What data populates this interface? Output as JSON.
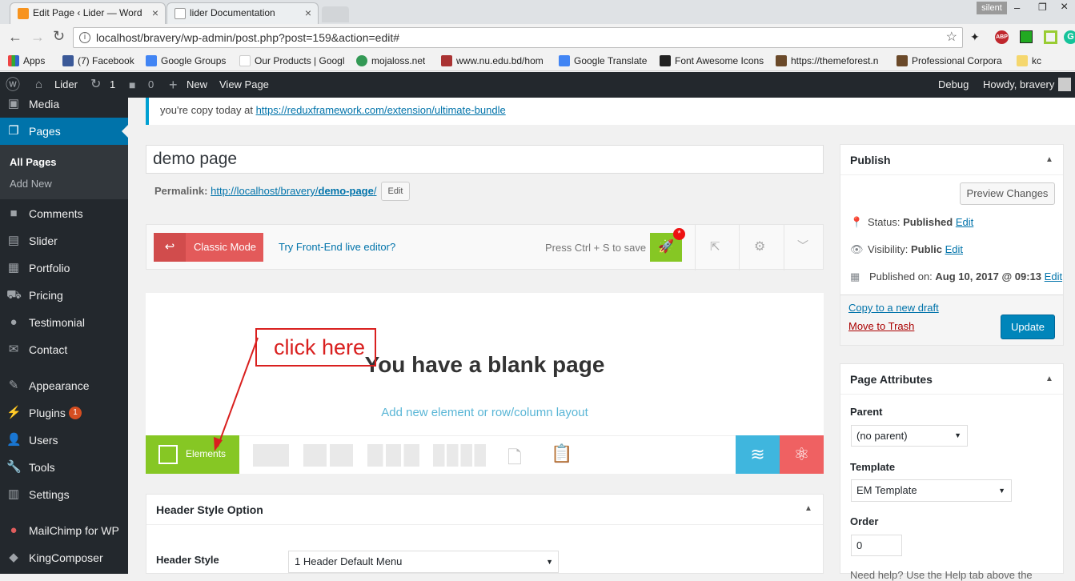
{
  "browser": {
    "tabs": [
      {
        "label": "Edit Page ‹ Lider — Word",
        "active": true
      },
      {
        "label": "lider Documentation",
        "active": false
      }
    ],
    "profile_label": "silent",
    "url": "localhost/bravery/wp-admin/post.php?post=159&action=edit#",
    "bookmarks": [
      "Apps",
      "(7) Facebook",
      "Google Groups",
      "Our Products | Googl",
      "mojaloss.net",
      "www.nu.edu.bd/hom",
      "Google Translate",
      "Font Awesome Icons",
      "https://themeforest.n",
      "Professional Corpora",
      "kc"
    ]
  },
  "adminbar": {
    "site": "Lider",
    "updates": "1",
    "comments": "0",
    "new": "New",
    "view": "View Page",
    "debug": "Debug",
    "howdy": "Howdy, bravery"
  },
  "sidebar": {
    "items": [
      {
        "label": "Media",
        "icon": "media-icon"
      },
      {
        "label": "Pages",
        "icon": "pages-icon"
      },
      {
        "label": "Comments",
        "icon": "comments-icon"
      },
      {
        "label": "Slider",
        "icon": "slider-icon"
      },
      {
        "label": "Portfolio",
        "icon": "portfolio-icon"
      },
      {
        "label": "Pricing",
        "icon": "pricing-icon"
      },
      {
        "label": "Testimonial",
        "icon": "testimonial-icon"
      },
      {
        "label": "Contact",
        "icon": "contact-icon"
      },
      {
        "label": "Appearance",
        "icon": "appearance-icon"
      },
      {
        "label": "Plugins",
        "icon": "plugins-icon"
      },
      {
        "label": "Users",
        "icon": "users-icon"
      },
      {
        "label": "Tools",
        "icon": "tools-icon"
      },
      {
        "label": "Settings",
        "icon": "settings-icon"
      },
      {
        "label": "MailChimp for WP",
        "icon": "mailchimp-icon"
      },
      {
        "label": "KingComposer",
        "icon": "kingcomposer-icon"
      }
    ],
    "sub_all_pages": "All Pages",
    "sub_add_new": "Add New",
    "plugins_badge": "1"
  },
  "notice": {
    "text": "you're copy today at",
    "link": "https://reduxframework.com/extension/ultimate-bundle"
  },
  "editor": {
    "title": "demo page",
    "permalink_label": "Permalink:",
    "permalink_base": "http://localhost/bravery/",
    "permalink_slug": "demo-page",
    "permalink_end": "/",
    "edit_btn": "Edit",
    "classic_mode": "Classic Mode",
    "frontend_link": "Try Front-End live editor?",
    "save_hint": "Press Ctrl + S to save",
    "blank_heading": "You have a blank page",
    "add_element": "Add new element or row/column layout",
    "elements_btn": "Elements",
    "annotation": "click here"
  },
  "header_style": {
    "title": "Header Style Option",
    "label": "Header Style",
    "value": "1 Header Default Menu"
  },
  "publish": {
    "title": "Publish",
    "preview": "Preview Changes",
    "status_label": "Status:",
    "status_value": "Published",
    "visibility_label": "Visibility:",
    "visibility_value": "Public",
    "published_label": "Published on:",
    "published_value": "Aug 10, 2017 @ 09:13",
    "edit": "Edit",
    "copy_draft": "Copy to a new draft",
    "trash": "Move to Trash",
    "update": "Update"
  },
  "attributes": {
    "title": "Page Attributes",
    "parent_label": "Parent",
    "parent_value": "(no parent)",
    "template_label": "Template",
    "template_value": "EM Template",
    "order_label": "Order",
    "order_value": "0",
    "help": "Need help? Use the Help tab above the"
  },
  "colors": {
    "accent": "#0073aa",
    "classic": "#e35a5a",
    "elements": "#86c724",
    "layers": "#3fb6de",
    "atom": "#ef6162",
    "annotation": "#d9201f"
  }
}
